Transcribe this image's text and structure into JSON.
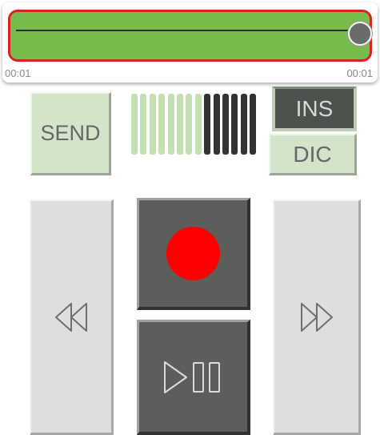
{
  "seek": {
    "time_left": "00:01",
    "time_right": "00:01",
    "progress": 1.0,
    "bar_color": "#78bb4d",
    "highlight_color": "#d9231f"
  },
  "controls": {
    "send_label": "SEND",
    "ins_label": "INS",
    "dic_label": "DIC",
    "ins_active": true
  },
  "level_meter": {
    "total_bars": 14,
    "lit_bars": 8,
    "lit_color": "#c4e0b3",
    "unlit_color": "#333333"
  },
  "transport": {
    "record_color": "#ff0000",
    "icons": [
      "rewind-icon",
      "record-icon",
      "play-pause-icon",
      "fast-forward-icon"
    ]
  }
}
